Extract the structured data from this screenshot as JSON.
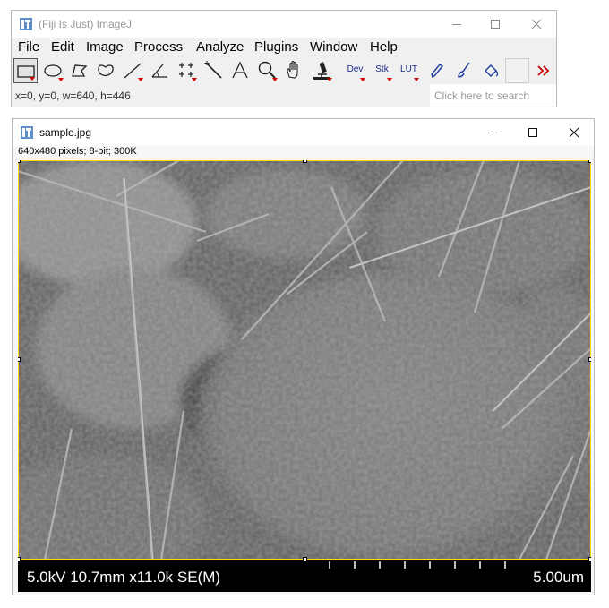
{
  "main_window": {
    "title": "(Fiji Is Just) ImageJ",
    "menu": [
      "File",
      "Edit",
      "Image",
      "Process",
      "Analyze",
      "Plugins",
      "Window",
      "Help"
    ],
    "tools": [
      {
        "name": "rectangle-tool",
        "icon": "rectangle-icon",
        "selected": true
      },
      {
        "name": "oval-tool",
        "icon": "oval-icon"
      },
      {
        "name": "polygon-tool",
        "icon": "polygon-icon"
      },
      {
        "name": "freehand-tool",
        "icon": "freehand-icon"
      },
      {
        "name": "line-tool",
        "icon": "line-icon"
      },
      {
        "name": "angle-tool",
        "icon": "angle-icon"
      },
      {
        "name": "point-tool",
        "icon": "multipoint-icon"
      },
      {
        "name": "wand-tool",
        "icon": "wand-icon"
      },
      {
        "name": "text-tool",
        "icon": "text-icon"
      },
      {
        "name": "zoom-tool",
        "icon": "magnifier-icon"
      },
      {
        "name": "hand-tool",
        "icon": "hand-icon"
      },
      {
        "name": "color-picker-tool",
        "icon": "microscope-icon"
      }
    ],
    "menu_tools": [
      "Dev",
      "Stk",
      "LUT"
    ],
    "status": "x=0, y=0, w=640, h=446",
    "search_placeholder": "Click here to search"
  },
  "image_window": {
    "title": "sample.jpg",
    "info": "640x480 pixels; 8-bit; 300K",
    "sem_info": "5.0kV 10.7mm x11.0k SE(M)",
    "scale_label": "5.00um",
    "selection_color": "#ffd800"
  }
}
